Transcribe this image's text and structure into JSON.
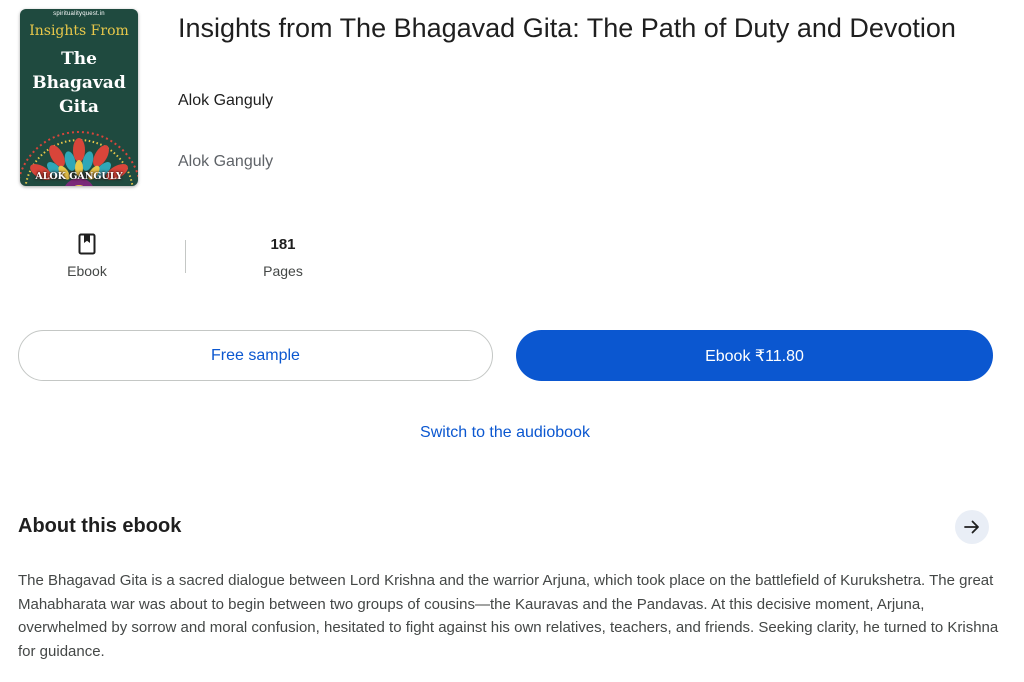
{
  "book": {
    "title": "Insights from The Bhagavad Gita: The Path of Duty and Devotion",
    "author": "Alok Ganguly",
    "author_secondary": "Alok Ganguly"
  },
  "cover": {
    "site": "spiritualityquest.in",
    "kicker": "Insights From",
    "title_line1": "The",
    "title_line2": "Bhagavad",
    "title_line3": "Gita",
    "author": "ALOK GANGULY",
    "background_color": "#1f4a3f",
    "accent_color": "#e8c84a"
  },
  "stats": {
    "format": {
      "icon": "bookmark-book-icon",
      "label": "Ebook"
    },
    "pages": {
      "value": "181",
      "label": "Pages"
    }
  },
  "actions": {
    "sample_label": "Free sample",
    "buy_label": "Ebook ₹11.80",
    "switch_label": "Switch to the audiobook"
  },
  "about": {
    "heading": "About this ebook",
    "arrow_icon": "arrow-right-icon",
    "description": "The Bhagavad Gita is a sacred dialogue between Lord Krishna and the warrior Arjuna, which took place on the battlefield of Kurukshetra. The great Mahabharata war was about to begin between two groups of cousins—the Kauravas and the Pandavas. At this decisive moment, Arjuna, overwhelmed by sorrow and moral confusion, hesitated to fight against his own relatives, teachers, and friends. Seeking clarity, he turned to Krishna for guidance."
  },
  "colors": {
    "primary": "#0b57d0",
    "text": "#1f1f1f",
    "secondary_text": "#444746",
    "border": "#c4c7c5"
  }
}
